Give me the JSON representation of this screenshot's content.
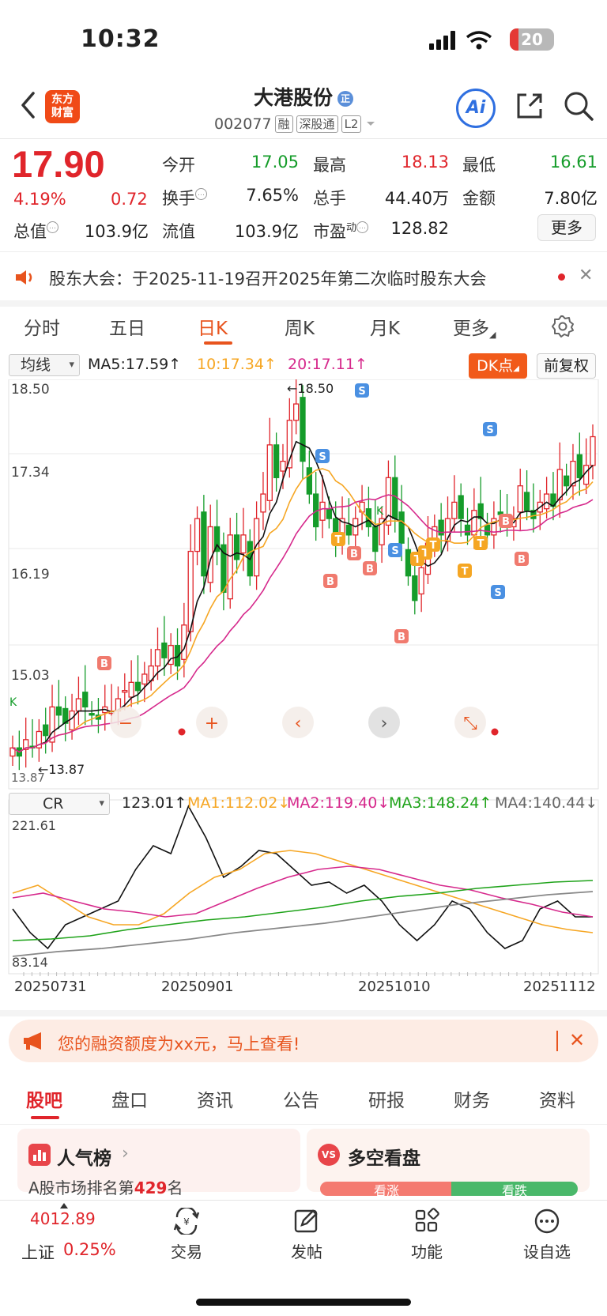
{
  "status_bar": {
    "time": "10:32",
    "battery": "20",
    "battery_level": 20
  },
  "header": {
    "logo": "东方\n财富",
    "stock_name": "大港股份",
    "name_badge": "正",
    "code": "002077",
    "tags": [
      "融",
      "深股通",
      "L2"
    ],
    "ai_label": "Ai"
  },
  "quote": {
    "price": "17.90",
    "change_pct": "4.19%",
    "change": "0.72",
    "open_label": "今开",
    "open": "17.05",
    "high_label": "最高",
    "high": "18.13",
    "low_label": "最低",
    "low": "16.61",
    "turnover_label": "换手",
    "turnover": "7.65%",
    "volume_label": "总手",
    "volume": "44.40万",
    "amount_label": "金额",
    "amount": "7.80亿",
    "mktcap_label": "总值",
    "mktcap": "103.9亿",
    "float_label": "流值",
    "float": "103.9亿",
    "pe_label": "市盈",
    "pe_sup": "动",
    "pe": "128.82",
    "more_label": "更多"
  },
  "notice": {
    "text": "股东大会：于2025-11-19召开2025年第二次临时股东大会"
  },
  "period_tabs": [
    "分时",
    "五日",
    "日K",
    "周K",
    "月K",
    "更多"
  ],
  "kchart_header": {
    "ma_select": "均线",
    "ma5": "MA5:17.59↑",
    "ma10": "10:17.34↑",
    "ma20": "20:17.11↑",
    "dk_button": "DK点",
    "adjust_button": "前复权"
  },
  "kchart_axis": {
    "y_labels": [
      "18.50",
      "17.34",
      "16.19",
      "15.03"
    ],
    "high_marker": "←18.50",
    "low_marker": "←13.87",
    "bottom_left": "13.87"
  },
  "signals": {
    "buy": "B",
    "sell": "S",
    "t": "T",
    "k": "K"
  },
  "cr_header": {
    "select": "CR",
    "value": "123.01↑",
    "ma1": "MA1:112.02↓",
    "ma2": "MA2:119.40↓",
    "ma3": "MA3:148.24↑",
    "ma4": "MA4:140.44↓",
    "y_top": "221.61",
    "y_bottom": "83.14"
  },
  "x_labels": [
    "20250731",
    "20250901",
    "20251010",
    "20251112"
  ],
  "colors": {
    "up": "#e0252b",
    "down": "#159c2a",
    "ma5": "#111111",
    "ma10": "#f6a623",
    "ma20": "#d6298c",
    "accent": "#e8541e"
  },
  "promo": {
    "text": "您的融资额度为xx元，马上查看!"
  },
  "bottom_tabs": [
    "股吧",
    "盘口",
    "资讯",
    "公告",
    "研报",
    "财务",
    "资料"
  ],
  "cards": {
    "popularity_title": "人气榜",
    "popularity_prefix": "A股市场排名第",
    "popularity_rank": "429",
    "popularity_suffix": "名",
    "vs_badge": "VS",
    "vs_title": "多空看盘",
    "vs_up": "看涨",
    "vs_down": "看跌"
  },
  "nav": {
    "index_value": "4012.89",
    "index_label": "上证",
    "index_pct": "0.25%",
    "items": [
      "交易",
      "发帖",
      "功能",
      "设自选"
    ]
  }
}
